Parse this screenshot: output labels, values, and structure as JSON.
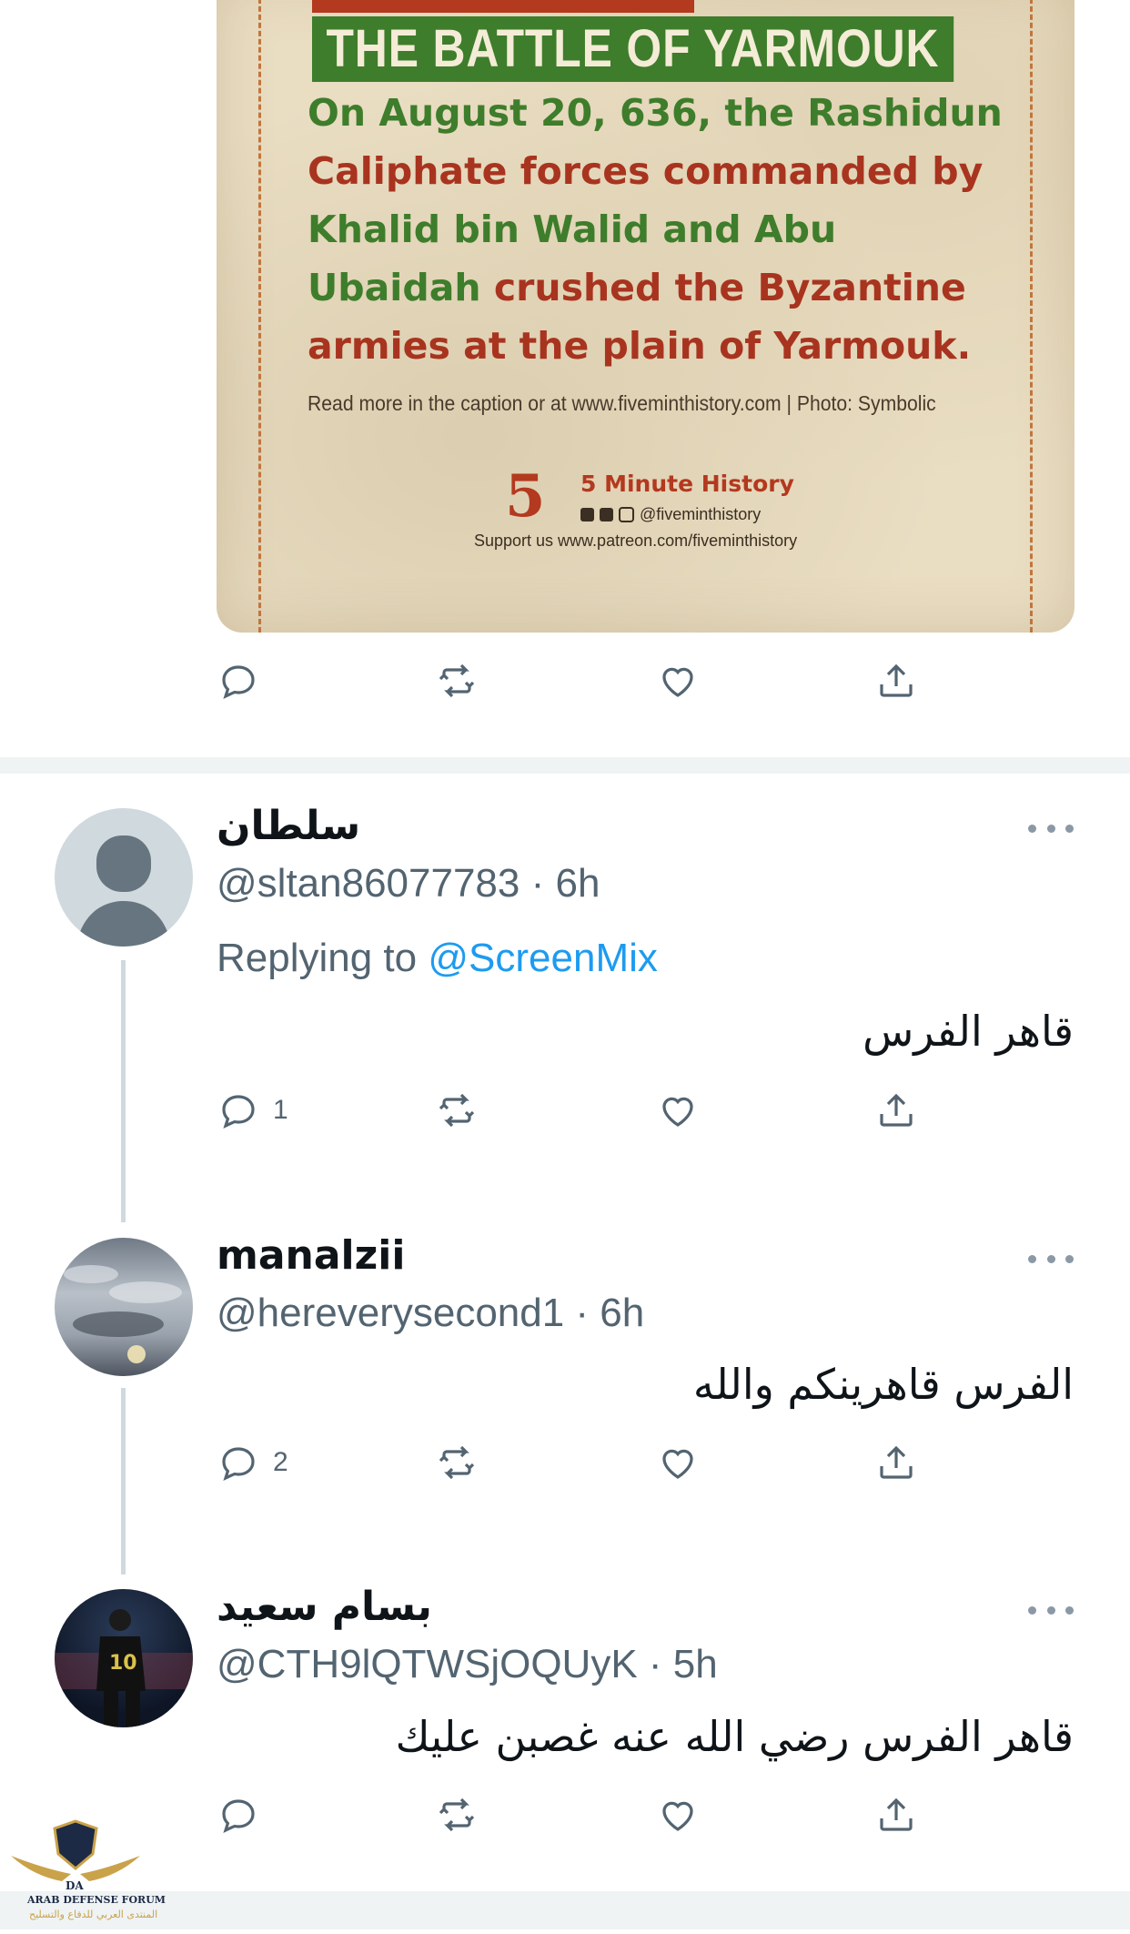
{
  "poster": {
    "title": "THE BATTLE OF YARMOUK",
    "body_segments": [
      {
        "text": "On August 20, 636, the Rashidun ",
        "color": "green"
      },
      {
        "text": "Caliphate forces commanded by ",
        "color": "red"
      },
      {
        "text": "Khalid bin Walid and Abu Ubaidah",
        "color": "green"
      },
      {
        "text": " crushed the Byzantine armies at the plain of Yarmouk.",
        "color": "red"
      }
    ],
    "readmore": "Read more in the caption or at www.fiveminthistory.com | Photo: Symbolic",
    "logo_digit": "5",
    "brand": "5 Minute History",
    "handle": "@fiveminthistory",
    "support": "Support us www.patreon.com/fiveminthistory"
  },
  "replies": [
    {
      "display_name": "سلطان",
      "handle_time": "@sltan86077783 · 6h",
      "replying_prefix": "Replying to ",
      "replying_to": "@ScreenMix",
      "text": "قاهر الفرس",
      "reply_count": "1"
    },
    {
      "display_name": "manalzii",
      "handle_time": "@hereverysecond1 · 6h",
      "text": "الفرس قاهرينكم والله",
      "reply_count": "2"
    },
    {
      "display_name": "بسام سعيد",
      "handle_time": "@CTH9lQTWSjOQUyK · 5h",
      "text": "قاهر الفرس رضي الله عنه غصبن عليك",
      "reply_count": ""
    }
  ],
  "watermark": {
    "line1": "ARAB DEFENSE FORUM",
    "line2": "المنتدى العربي للدفاع والتسليح",
    "badge": "DA"
  },
  "colors": {
    "accent": "#1d9bf0",
    "icon_gray": "#536471",
    "poster_green": "#3e7d2b",
    "poster_red": "#a8341f"
  },
  "icons": [
    "reply-icon",
    "retweet-icon",
    "like-icon",
    "share-icon",
    "more-icon"
  ]
}
